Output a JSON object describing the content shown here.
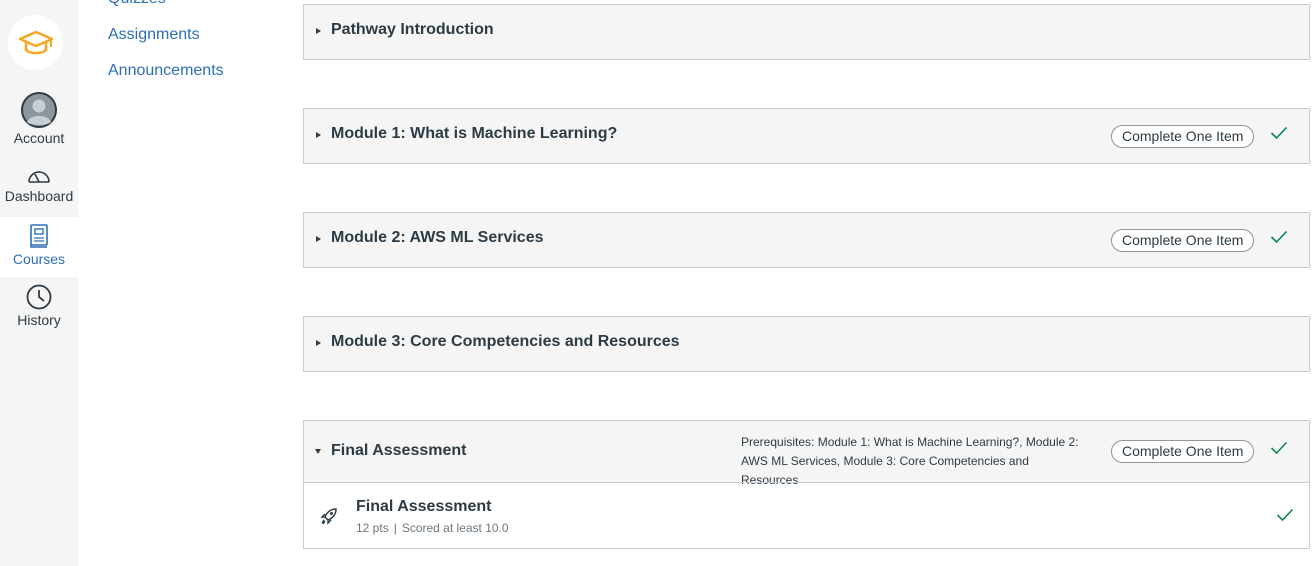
{
  "global_nav": {
    "items": [
      {
        "label": "Account",
        "icon": "account-avatar-icon"
      },
      {
        "label": "Dashboard",
        "icon": "dashboard-speedometer-icon"
      },
      {
        "label": "Courses",
        "icon": "courses-book-icon",
        "active": true
      },
      {
        "label": "History",
        "icon": "history-clock-icon"
      }
    ]
  },
  "course_nav": {
    "items": [
      {
        "label": "Quizzes"
      },
      {
        "label": "Assignments"
      },
      {
        "label": "Announcements"
      }
    ]
  },
  "modules": [
    {
      "title": "Pathway Introduction"
    },
    {
      "title": "Module 1: What is Machine Learning?",
      "requirement": "Complete One Item",
      "completed": true
    },
    {
      "title": "Module 2: AWS ML Services",
      "requirement": "Complete One Item",
      "completed": true
    },
    {
      "title": "Module 3: Core Competencies and Resources"
    },
    {
      "title": "Final Assessment",
      "prerequisites": "Prerequisites: Module 1: What is Machine Learning?, Module 2: AWS ML Services, Module 3: Core Competencies and Resources",
      "requirement": "Complete One Item",
      "completed": true,
      "expanded": true,
      "items": [
        {
          "title": "Final Assessment",
          "points": "12 pts",
          "separator": "|",
          "requirement": "Scored at least 10.0",
          "icon": "quiz-rocket-icon",
          "completed": true
        }
      ]
    }
  ],
  "colors": {
    "link": "#2d6fb5",
    "success": "#0b874b",
    "logo": "#f5a623",
    "header_bg": "#f5f5f5",
    "border": "#c7cdd1"
  }
}
